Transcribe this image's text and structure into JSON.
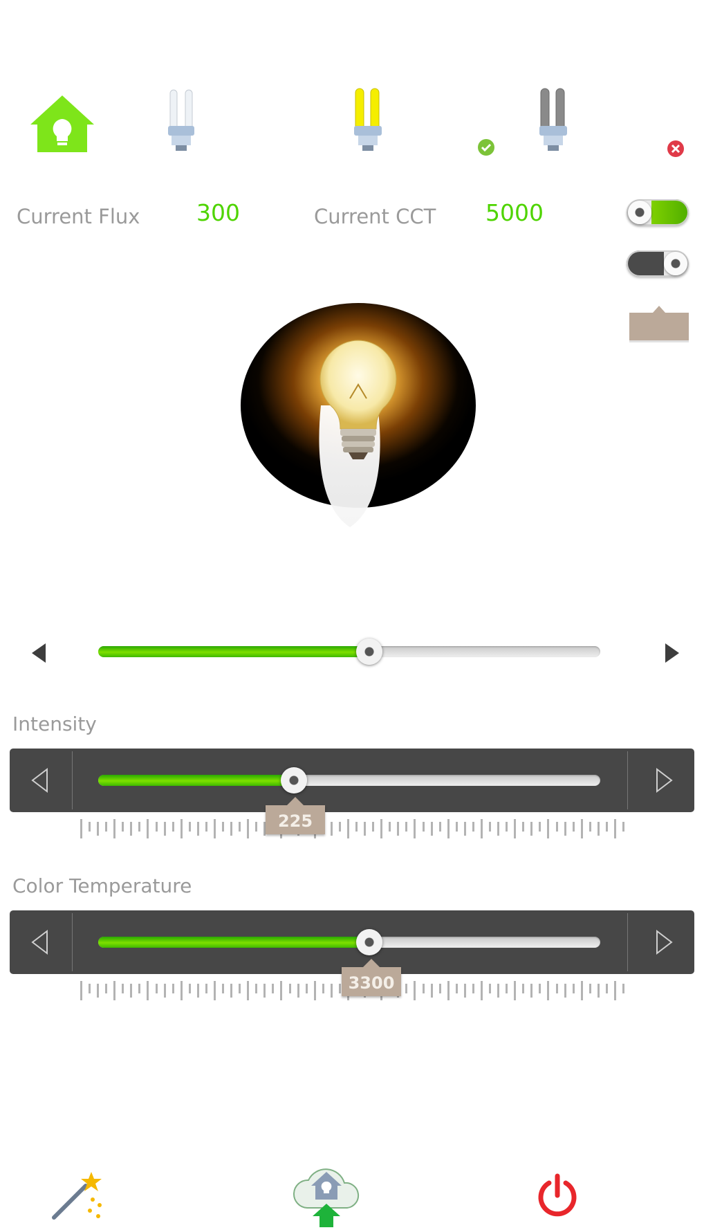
{
  "status": {
    "flux_label": "Current Flux",
    "flux_value": "300",
    "cct_label": "Current CCT",
    "cct_value": "5000"
  },
  "brightness_slider": {
    "value_fraction": 0.54
  },
  "intensity": {
    "label": "Intensity",
    "value": "225",
    "fraction": 0.39
  },
  "color_temperature": {
    "label": "Color Temperature",
    "value": "3300",
    "fraction": 0.54
  },
  "toggles": {
    "toggle_1": "on",
    "toggle_2": "off"
  },
  "colors": {
    "accent_green": "#4ed400",
    "home_green": "#7ee51a",
    "power_red": "#e8262b",
    "badge_tan": "#bba999",
    "panel_dark": "#474747"
  }
}
